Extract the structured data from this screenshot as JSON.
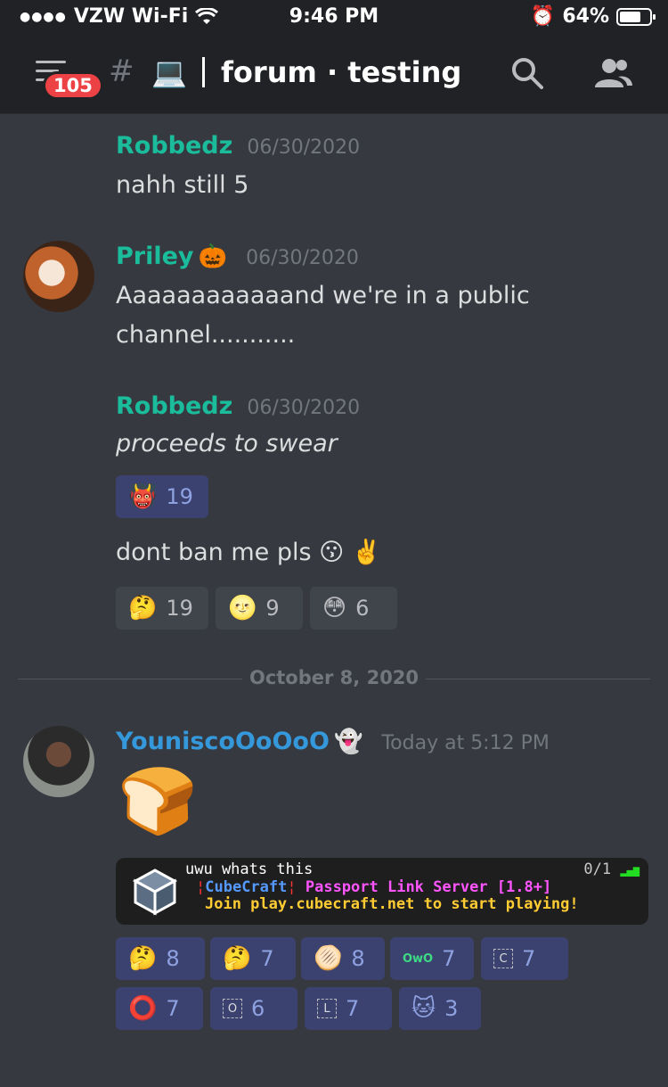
{
  "status_bar": {
    "carrier": "VZW Wi-Fi",
    "time": "9:46 PM",
    "battery": "64%",
    "battery_level": 0.64
  },
  "header": {
    "badge_count": "105",
    "channel_emoji": "💻",
    "title": "forum · testing"
  },
  "messages": [
    {
      "author": "Robbedz",
      "author_color": "#1abc9c",
      "timestamp": "06/30/2020",
      "text": "nahh still 5"
    },
    {
      "author": "Priley",
      "author_emoji": "🎃",
      "author_color": "#1abc9c",
      "timestamp": "06/30/2020",
      "text_line1": "Aaaaaaaaaaaand we're in a public",
      "text_line2": "channel..........."
    },
    {
      "author": "Robbedz",
      "author_color": "#1abc9c",
      "timestamp": "06/30/2020",
      "text": "proceeds to swear",
      "reactions": [
        {
          "emoji": "👹",
          "count": "19"
        }
      ]
    },
    {
      "text": "dont ban me pls 😗 ✌️",
      "reactions": [
        {
          "emoji": "🤔",
          "count": "19"
        },
        {
          "emoji": "🌝",
          "count": "9"
        },
        {
          "emoji": "😳",
          "count": "6"
        }
      ]
    }
  ],
  "divider": {
    "date": "October 8, 2020"
  },
  "last_message": {
    "author": "YouniscoOoOoO",
    "author_emoji": "👻",
    "author_color": "#3498db",
    "timestamp": "Today at 5:12 PM",
    "sticker": "🍞",
    "embed": {
      "line1": "uwu whats this",
      "line2_server": "CubeCraft",
      "line2_rest": "Passport Link Server [1.8+]",
      "line3": "Join play.cubecraft.net to start playing!",
      "players": "0/1"
    },
    "reactions_row1": [
      {
        "emoji": "🤔",
        "count": "8"
      },
      {
        "emoji": "🤔",
        "count": "7"
      },
      {
        "emoji": "🫓",
        "count": "8"
      },
      {
        "emoji": "OwO",
        "count": "7"
      },
      {
        "emoji": "C",
        "count": "7"
      }
    ],
    "reactions_row2": [
      {
        "emoji": "⭕",
        "count": "7"
      },
      {
        "emoji": "O",
        "count": "6"
      },
      {
        "emoji": "L",
        "count": "7"
      },
      {
        "emoji": "🐱",
        "count": "3"
      }
    ]
  }
}
